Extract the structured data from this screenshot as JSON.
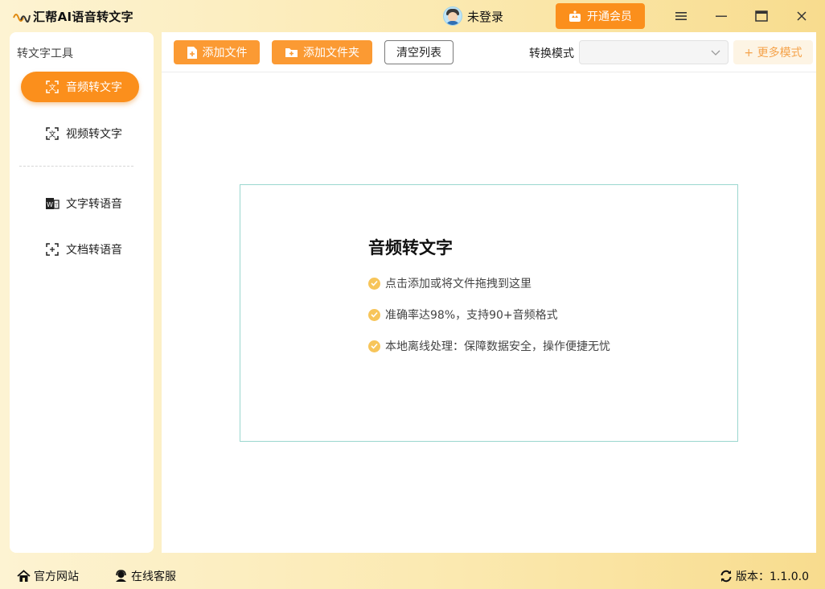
{
  "app": {
    "title": "汇帮AI语音转文字"
  },
  "user": {
    "name": "未登录"
  },
  "vip_button": {
    "label": "开通会员"
  },
  "window_controls": [
    "menu",
    "minimize",
    "maximize",
    "close"
  ],
  "sidebar": {
    "title": "转文字工具",
    "items": [
      {
        "label": "音频转文字",
        "icon": "audio-to-text-icon",
        "active": true
      },
      {
        "label": "视频转文字",
        "icon": "video-to-text-icon",
        "active": false
      },
      {
        "label": "文字转语音",
        "icon": "text-to-speech-icon",
        "active": false
      },
      {
        "label": "文档转语音",
        "icon": "document-to-speech-icon",
        "active": false
      }
    ]
  },
  "toolbar": {
    "add_file": "添加文件",
    "add_folder": "添加文件夹",
    "clear_list": "清空列表",
    "mode_label": "转换模式",
    "mode_value": "",
    "more_modes": "+ 更多模式"
  },
  "drop_zone": {
    "title": "音频转文字",
    "features": [
      "点击添加或将文件拖拽到这里",
      "准确率达98%，支持90+音频格式",
      "本地离线处理：保障数据安全，操作便捷无忧"
    ]
  },
  "footer": {
    "website": "官方网站",
    "support": "在线客服",
    "version": "版本：1.1.0.0"
  },
  "colors": {
    "accent": "#fb8f1c",
    "button": "#fb9a33",
    "check": "#f7c55a",
    "drop_border": "#9bd7cf"
  }
}
